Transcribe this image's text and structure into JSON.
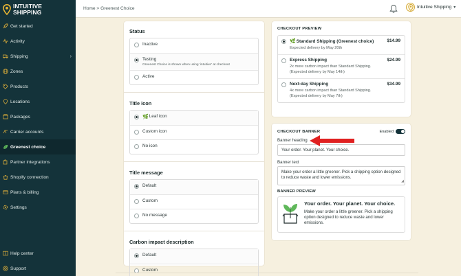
{
  "brand": {
    "line1": "INTUITIVE",
    "line2": "SHIPPING"
  },
  "sidebar": {
    "items": [
      {
        "label": "Get started",
        "icon": "rocket-icon"
      },
      {
        "label": "Activity",
        "icon": "activity-icon"
      },
      {
        "label": "Shipping",
        "icon": "truck-icon",
        "chevron": "›"
      },
      {
        "label": "Zones",
        "icon": "globe-icon"
      },
      {
        "label": "Products",
        "icon": "tag-icon"
      },
      {
        "label": "Locations",
        "icon": "location-icon"
      },
      {
        "label": "Packages",
        "icon": "package-icon"
      },
      {
        "label": "Carrier accounts",
        "icon": "carrier-icon"
      },
      {
        "label": "Greenest choice",
        "icon": "leaf-icon",
        "active": true
      },
      {
        "label": "Partner integrations",
        "icon": "puzzle-icon"
      },
      {
        "label": "Shopify connection",
        "icon": "shopify-icon"
      },
      {
        "label": "Plans & billing",
        "icon": "billing-icon"
      },
      {
        "label": "Settings",
        "icon": "gear-icon"
      }
    ],
    "bottom": [
      {
        "label": "Help center",
        "icon": "help-icon"
      },
      {
        "label": "Support",
        "icon": "support-icon"
      }
    ]
  },
  "topbar": {
    "breadcrumb": "Home > Greenest Choice",
    "account": "Intuitive Shipping",
    "account_chevron": "▾"
  },
  "settings": {
    "status": {
      "title": "Status",
      "options": [
        {
          "label": "Inactive",
          "selected": false
        },
        {
          "label": "Testing",
          "selected": true,
          "help": "Greenest Choice is shown when using 'intuitive' at checkout"
        },
        {
          "label": "Active",
          "selected": false
        }
      ]
    },
    "title_icon": {
      "title": "Title icon",
      "options": [
        {
          "label": "Leaf icon",
          "selected": true
        },
        {
          "label": "Custom icon",
          "selected": false
        },
        {
          "label": "No icon",
          "selected": false
        }
      ]
    },
    "title_message": {
      "title": "Title message",
      "options": [
        {
          "label": "Default",
          "selected": true
        },
        {
          "label": "Custom",
          "selected": false
        },
        {
          "label": "No message",
          "selected": false
        }
      ]
    },
    "carbon": {
      "title": "Carbon impact description",
      "options": [
        {
          "label": "Default",
          "selected": true
        },
        {
          "label": "Custom",
          "selected": false
        }
      ]
    }
  },
  "checkout_preview": {
    "label": "CHECKOUT PREVIEW",
    "options": [
      {
        "name": "Standard Shipping (Greenest choice)",
        "price": "$14.99",
        "desc1": "Expected delivery by May 20th",
        "desc2": "",
        "selected": true
      },
      {
        "name": "Express Shipping",
        "price": "$24.99",
        "desc1": "2x more carbon impact than Standard Shipping.",
        "desc2": "(Expected delivery by May 14th)",
        "selected": false
      },
      {
        "name": "Next-day Shipping",
        "price": "$34.99",
        "desc1": "4x more carbon impact than Standard Shipping.",
        "desc2": "(Expected delivery by May 7th)",
        "selected": false
      }
    ]
  },
  "checkout_banner": {
    "label": "CHECKOUT BANNER",
    "enabled_label": "Enabled",
    "enabled": true,
    "heading_label": "Banner heading",
    "heading_value": "Your order. Your planet. Your choice.",
    "text_label": "Banner text",
    "text_value": "Make your order a little greener. Pick a shipping option designed to reduce waste and lower emissions.",
    "preview_label": "BANNER PREVIEW",
    "preview_title": "Your order. Your planet. Your choice.",
    "preview_text": "Make your order a little greener. Pick a shipping option designed to reduce waste and lower emissions."
  },
  "colors": {
    "sidebar_bg": "#14333a",
    "page_bg": "#f6f0df",
    "accent_gold": "#d4a93a",
    "leaf_green": "#46a146",
    "arrow_red": "#e02020"
  }
}
